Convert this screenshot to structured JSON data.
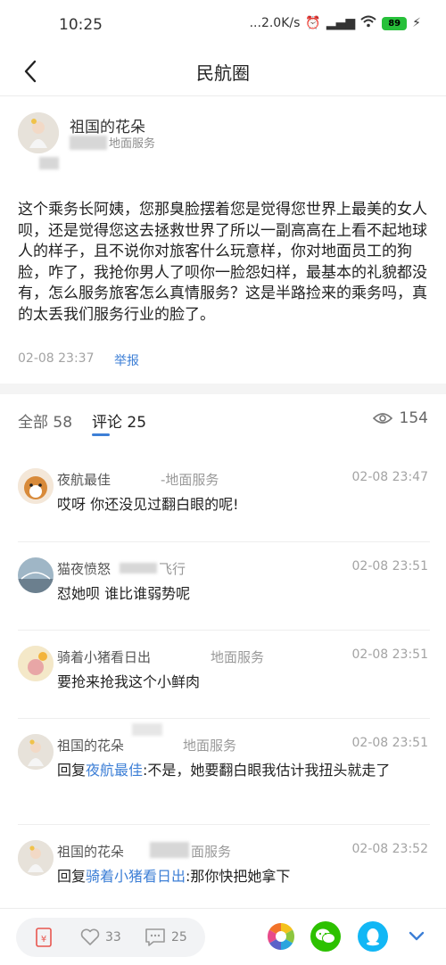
{
  "status_bar": {
    "time": "10:25",
    "speed": "...2.0K/s",
    "battery": "89"
  },
  "nav": {
    "title": "民航圈"
  },
  "post": {
    "author_name": "祖国的花朵",
    "author_tag": "地面服务",
    "text": "这个乘务长阿姨，您那臭脸摆着您是觉得您世界上最美的女人呗，还是觉得您这去拯救世界了所以一副高高在上看不起地球人的样子，且不说你对旅客什么玩意样，你对地面员工的狗脸，咋了，我抢你男人了呗你一脸怨妇样，最基本的礼貌都没有，怎么服务旅客怎么真情服务？这是半路捡来的乘务吗，真的太丢我们服务行业的脸了。",
    "time": "02-08 23:37",
    "report": "举报"
  },
  "tabs": {
    "all": "全部 58",
    "comments": "评论 25",
    "views": "154"
  },
  "comments": [
    {
      "name": "夜航最佳",
      "tag": "-地面服务",
      "time": "02-08 23:47",
      "text": "哎呀 你还没见过翻白眼的呢!"
    },
    {
      "name": "猫夜愤怒",
      "tag": "飞行",
      "time": "02-08 23:51",
      "text": "怼她呗 谁比谁弱势呢"
    },
    {
      "name": "骑着小猪看日出",
      "tag": "地面服务",
      "time": "02-08 23:51",
      "text": "要抢来抢我这个小鲜肉"
    },
    {
      "name": "祖国的花朵",
      "tag": "地面服务",
      "time": "02-08 23:51",
      "reply_prefix": "回复",
      "mention": "夜航最佳",
      "text": ":不是，她要翻白眼我估计我扭头就走了"
    },
    {
      "name": "祖国的花朵",
      "tag": "面服务",
      "time": "02-08 23:52",
      "reply_prefix": "回复",
      "mention": "骑着小猪看日出",
      "text": ":那你快把她拿下"
    }
  ],
  "bottom": {
    "likes": "33",
    "comments": "25"
  },
  "colors": {
    "accent": "#3d7fd6",
    "wechat": "#2dc100",
    "qq": "#12b7f5"
  }
}
